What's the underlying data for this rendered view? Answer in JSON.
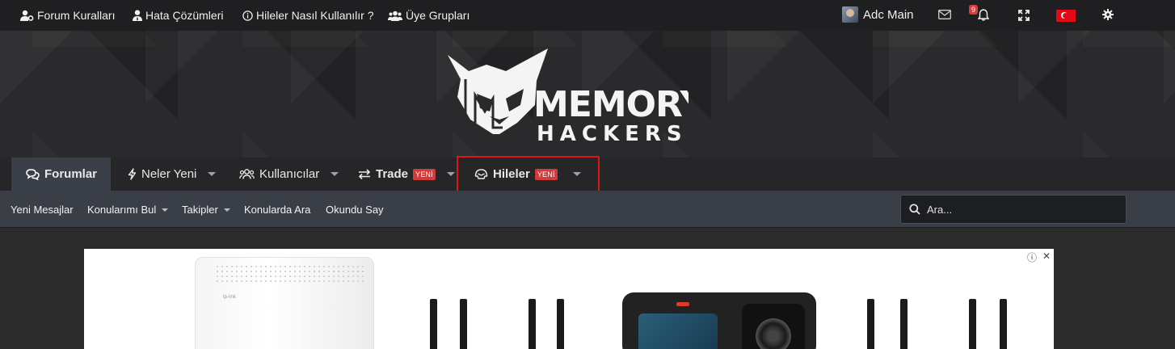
{
  "topbar": {
    "links": [
      {
        "label": "Forum Kuralları",
        "icon": "user-cog-icon"
      },
      {
        "label": "Hata Çözümleri",
        "icon": "user-tie-icon"
      },
      {
        "label": "Hileler Nasıl Kullanılır ?",
        "icon": "info-circle-icon"
      },
      {
        "label": "Üye Grupları",
        "icon": "users-icon"
      }
    ],
    "user": {
      "name": "Adc Main"
    },
    "notification_count": "9",
    "icons": [
      "envelope-icon",
      "bell-icon",
      "expand-icon",
      "turkey-flag-icon",
      "gear-icon"
    ]
  },
  "logo": {
    "line1": "MEMORY",
    "line2": "HACKERS"
  },
  "nav": {
    "tabs": [
      {
        "label": "Forumlar",
        "active": true,
        "icon": "comments-icon"
      },
      {
        "label": "Neler Yeni",
        "icon": "bolt-icon"
      },
      {
        "label": "Kullanıcılar",
        "icon": "users-icon"
      },
      {
        "label": "Trade",
        "badge": "YENİ",
        "icon": "exchange-icon"
      },
      {
        "label": "Hileler",
        "badge": "YENİ",
        "icon": "helmet-icon"
      }
    ]
  },
  "subnav": {
    "links": [
      {
        "label": "Yeni Mesajlar"
      },
      {
        "label": "Konularımı Bul"
      },
      {
        "label": "Takipler"
      },
      {
        "label": "Konularda Ara"
      },
      {
        "label": "Okundu Say"
      }
    ],
    "search_placeholder": "Ara..."
  },
  "ad": {
    "brand": "tp-link",
    "info_glyph": "ⓘ",
    "close_glyph": "✕"
  },
  "colors": {
    "topbar": "#1f1f21",
    "active_tab": "#3b3f47",
    "subnav": "#3a3e46",
    "badge": "#d23b3b",
    "highlight": "#e01414"
  }
}
